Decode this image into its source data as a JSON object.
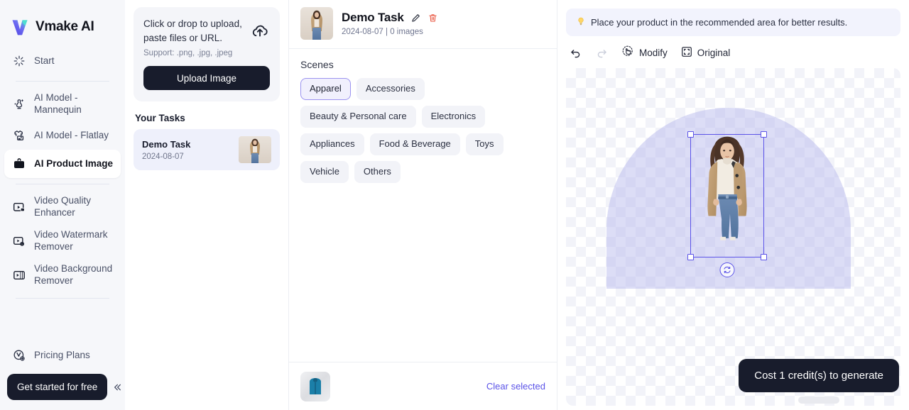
{
  "brand": {
    "name": "Vmake AI",
    "logo_icon": "v-logo-icon"
  },
  "sidebar": {
    "items": [
      {
        "label": "Start",
        "icon": "sparkle-icon"
      },
      {
        "label": "AI Model -\nMannequin",
        "icon": "mannequin-icon"
      },
      {
        "label": "AI Model - Flatlay",
        "icon": "flatlay-shirt-icon"
      },
      {
        "label": "AI Product Image",
        "icon": "bag-icon"
      },
      {
        "label": "Video Quality\nEnhancer",
        "icon": "video-4k-icon"
      },
      {
        "label": "Video Watermark\nRemover",
        "icon": "video-watermark-icon"
      },
      {
        "label": "Video Background\nRemover",
        "icon": "video-background-icon"
      },
      {
        "label": "Pricing Plans",
        "icon": "pricing-coin-icon"
      }
    ],
    "active_label": "AI Product Image",
    "cta_label": "Get started for free",
    "collapse_icon": "double-chevron-left-icon"
  },
  "tasks_panel": {
    "upload": {
      "title": "Click or drop to upload, paste files or URL.",
      "support": "Support: .png, .jpg, .jpeg",
      "button_label": "Upload Image",
      "cloud_icon": "cloud-upload-icon"
    },
    "section_title": "Your Tasks",
    "tasks": [
      {
        "name": "Demo Task",
        "date": "2024-08-07",
        "thumb_alt": "woman-in-trench-coat-thumbnail"
      }
    ]
  },
  "center": {
    "header": {
      "title": "Demo Task",
      "meta": "2024-08-07 | 0 images",
      "edit_icon": "pencil-edit-icon",
      "delete_icon": "trash-delete-icon",
      "thumb_alt": "woman-in-trench-coat-thumbnail"
    },
    "scenes": {
      "title": "Scenes",
      "selected": "Apparel",
      "chips": [
        "Apparel",
        "Accessories",
        "Beauty & Personal care",
        "Electronics",
        "Appliances",
        "Food & Beverage",
        "Toys",
        "Vehicle",
        "Others"
      ]
    },
    "footer": {
      "clear_label": "Clear selected",
      "thumb_alt": "blue-jacket-thumbnail"
    }
  },
  "right": {
    "tip": "Place your product in the recommended area for better results.",
    "tip_icon": "lightbulb-icon",
    "toolbar": {
      "undo_icon": "undo-arrow-icon",
      "redo_icon": "redo-arrow-icon",
      "modify_label": "Modify",
      "modify_icon": "modify-cursor-icon",
      "original_label": "Original",
      "original_icon": "fullscreen-frame-icon"
    },
    "canvas": {
      "rotate_icon": "rotate-handle-icon",
      "subject_alt": "woman-in-trench-coat-cutout"
    },
    "generate_label": "Cost 1 credit(s) to generate"
  },
  "colors": {
    "accent": "#5b53e8",
    "dark": "#181c2c",
    "sidebar_bg": "#f6f7fa",
    "chip_bg": "#f2f3f8",
    "chip_selected_bg": "#f1f0fd",
    "chip_selected_border": "#9b93f0",
    "tip_bg": "#f2f3fd",
    "task_card_bg": "#eef0fb",
    "arch_fill": "#b2b4eb",
    "delete_red": "#e8503a"
  }
}
